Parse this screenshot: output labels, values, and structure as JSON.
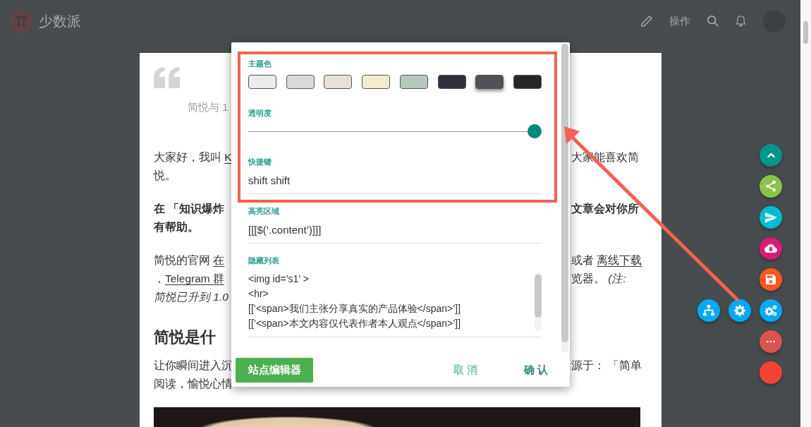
{
  "header": {
    "brand": "少数派",
    "action_label": "操作"
  },
  "article": {
    "caption": "简悦与 1",
    "blocks": [
      {
        "kind": "paragraph",
        "lines": [
          {
            "left": [
              {
                "kind": "text",
                "text": "大家好，我叫 "
              },
              {
                "kind": "link",
                "text": "K"
              }
            ],
            "right": [
              {
                "kind": "text",
                "text": "大家能喜欢简"
              }
            ]
          },
          {
            "left": [
              {
                "kind": "text",
                "text": "悦。"
              }
            ]
          }
        ]
      },
      {
        "kind": "lead",
        "lines": [
          {
            "left": [
              {
                "kind": "text",
                "text": "在 「知识爆炸"
              }
            ],
            "right": [
              {
                "kind": "text",
                "text": "文章会对你所"
              }
            ]
          },
          {
            "left": [
              {
                "kind": "text",
                "text": "有帮助。"
              }
            ]
          }
        ]
      },
      {
        "kind": "paragraph",
        "lines": [
          {
            "left": [
              {
                "kind": "text",
                "text": "简悦的官网 "
              },
              {
                "kind": "link",
                "text": "在"
              }
            ],
            "right": [
              {
                "kind": "text",
                "text": "或者 "
              },
              {
                "kind": "link",
                "text": "离线下载"
              }
            ]
          },
          {
            "left": [
              {
                "kind": "text",
                "text": "，"
              },
              {
                "kind": "link",
                "text": "Telegram 群"
              }
            ],
            "right": [
              {
                "kind": "text",
                "text": "览器。 "
              },
              {
                "kind": "italic",
                "text": "(注:"
              }
            ]
          },
          {
            "left": [
              {
                "kind": "italic",
                "text": "简悦已升到 1.0"
              }
            ]
          }
        ]
      },
      {
        "kind": "heading",
        "lines": [
          {
            "left": [
              {
                "kind": "text",
                "text": "简悦是什"
              }
            ]
          }
        ]
      },
      {
        "kind": "paragraph",
        "lines": [
          {
            "left": [
              {
                "kind": "text",
                "text": "让你瞬间进入沉"
              }
            ],
            "right": [
              {
                "kind": "text",
                "text": "源于： 「简单"
              }
            ]
          },
          {
            "left": [
              {
                "kind": "text",
                "text": "阅读，愉悦心情"
              }
            ]
          }
        ]
      }
    ]
  },
  "dialog": {
    "fields": [
      {
        "kind": "swatches",
        "label": "主题色",
        "swatches": [
          {
            "color": "#ececec",
            "selected": false
          },
          {
            "color": "#d9d9d9",
            "selected": false
          },
          {
            "color": "#e8e1d6",
            "selected": false
          },
          {
            "color": "#f5ecd0",
            "selected": false
          },
          {
            "color": "#b7c9bd",
            "selected": false
          },
          {
            "color": "#2e313c",
            "selected": false
          },
          {
            "color": "#4f5358",
            "selected": true
          },
          {
            "color": "#252627",
            "selected": false
          }
        ]
      },
      {
        "kind": "slider",
        "label": "透明度",
        "level": 1
      },
      {
        "kind": "input",
        "label": "快捷键",
        "value": "shift shift"
      },
      {
        "kind": "input",
        "label": "高亮区域",
        "value": "[[[$(’.content’)]]]"
      },
      {
        "kind": "textarea",
        "label": "隐藏列表",
        "lines": [
          "<img id=’s1’ >",
          "<hr>",
          "[[’<span>我们主张分享真实的产品体验</span>’]]",
          "[[’<span>本文内容仅代表作者本人观点</span>’]]"
        ]
      }
    ],
    "buttons": [
      {
        "kind": "primary",
        "label": "站点编辑器"
      },
      {
        "kind": "cancel",
        "label": "取 消"
      },
      {
        "kind": "confirm",
        "label": "确 认"
      }
    ]
  },
  "floating_buttons": [
    {
      "kind": "chevron-up",
      "color": "#009688"
    },
    {
      "kind": "share",
      "color": "#8bc34a"
    },
    {
      "kind": "send",
      "color": "#00bcd4"
    },
    {
      "kind": "cloud-download",
      "color": "#d81b73"
    },
    {
      "kind": "save",
      "color": "#ff5722"
    },
    {
      "kind": "gears",
      "color": "#03a9f4",
      "extras": [
        {
          "kind": "sitemap",
          "color": "#03a9f4"
        },
        {
          "kind": "gear",
          "color": "#03a9f4"
        }
      ]
    },
    {
      "kind": "more",
      "color": "#d9534f"
    },
    {
      "kind": "plain",
      "color": "#f44336"
    }
  ]
}
